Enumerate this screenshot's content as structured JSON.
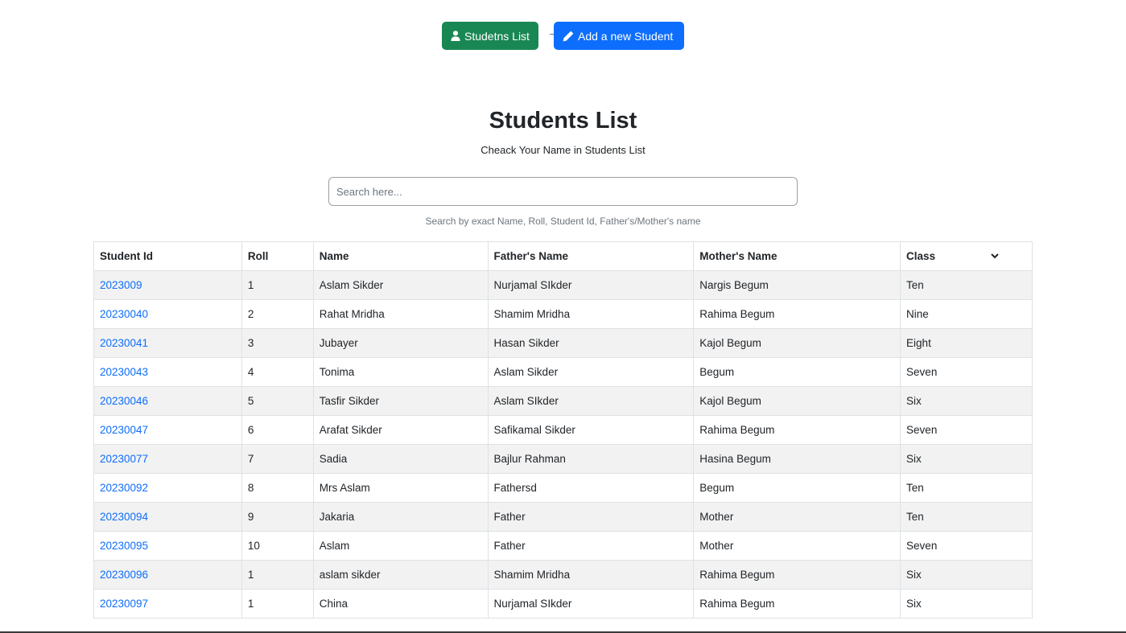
{
  "nav": {
    "students_list_label": "Studetns List",
    "add_student_label": "Add a new Student"
  },
  "header": {
    "title": "Students List",
    "subtitle": "Cheack Your Name in Students List"
  },
  "search": {
    "placeholder": "Search here...",
    "value": "",
    "help_text": "Search by exact Name, Roll, Student Id, Father's/Mother's name"
  },
  "table": {
    "columns": [
      "Student Id",
      "Roll",
      "Name",
      "Father's Name",
      "Mother's Name",
      "Class"
    ],
    "rows": [
      {
        "id": "2023009",
        "roll": "1",
        "name": "Aslam Sikder",
        "father": "Nurjamal SIkder",
        "mother": "Nargis Begum",
        "class": "Ten"
      },
      {
        "id": "20230040",
        "roll": "2",
        "name": "Rahat Mridha",
        "father": "Shamim Mridha",
        "mother": "Rahima Begum",
        "class": "Nine"
      },
      {
        "id": "20230041",
        "roll": "3",
        "name": "Jubayer",
        "father": "Hasan Sikder",
        "mother": "Kajol Begum",
        "class": "Eight"
      },
      {
        "id": "20230043",
        "roll": "4",
        "name": "Tonima",
        "father": "Aslam Sikder",
        "mother": "Begum",
        "class": "Seven"
      },
      {
        "id": "20230046",
        "roll": "5",
        "name": "Tasfir Sikder",
        "father": "Aslam SIkder",
        "mother": "Kajol Begum",
        "class": "Six"
      },
      {
        "id": "20230047",
        "roll": "6",
        "name": "Arafat Sikder",
        "father": "Safikamal Sikder",
        "mother": "Rahima Begum",
        "class": "Seven"
      },
      {
        "id": "20230077",
        "roll": "7",
        "name": "Sadia",
        "father": "Bajlur Rahman",
        "mother": "Hasina Begum",
        "class": "Six"
      },
      {
        "id": "20230092",
        "roll": "8",
        "name": "Mrs Aslam",
        "father": "Fathersd",
        "mother": "Begum",
        "class": "Ten"
      },
      {
        "id": "20230094",
        "roll": "9",
        "name": "Jakaria",
        "father": "Father",
        "mother": "Mother",
        "class": "Ten"
      },
      {
        "id": "20230095",
        "roll": "10",
        "name": "Aslam",
        "father": "Father",
        "mother": "Mother",
        "class": "Seven"
      },
      {
        "id": "20230096",
        "roll": "1",
        "name": "aslam sikder",
        "father": "Shamim Mridha",
        "mother": "Rahima Begum",
        "class": "Six"
      },
      {
        "id": "20230097",
        "roll": "1",
        "name": "China",
        "father": "Nurjamal SIkder",
        "mother": "Rahima Begum",
        "class": "Six"
      }
    ]
  },
  "colors": {
    "green_button": "#198754",
    "blue_button": "#0d6efd",
    "link": "#0d6efd",
    "striped_row": "#f2f2f2"
  },
  "icons": {
    "students_list": "user-icon",
    "add_student": "pencil-icon",
    "class_sort": "chevron-down-icon"
  }
}
